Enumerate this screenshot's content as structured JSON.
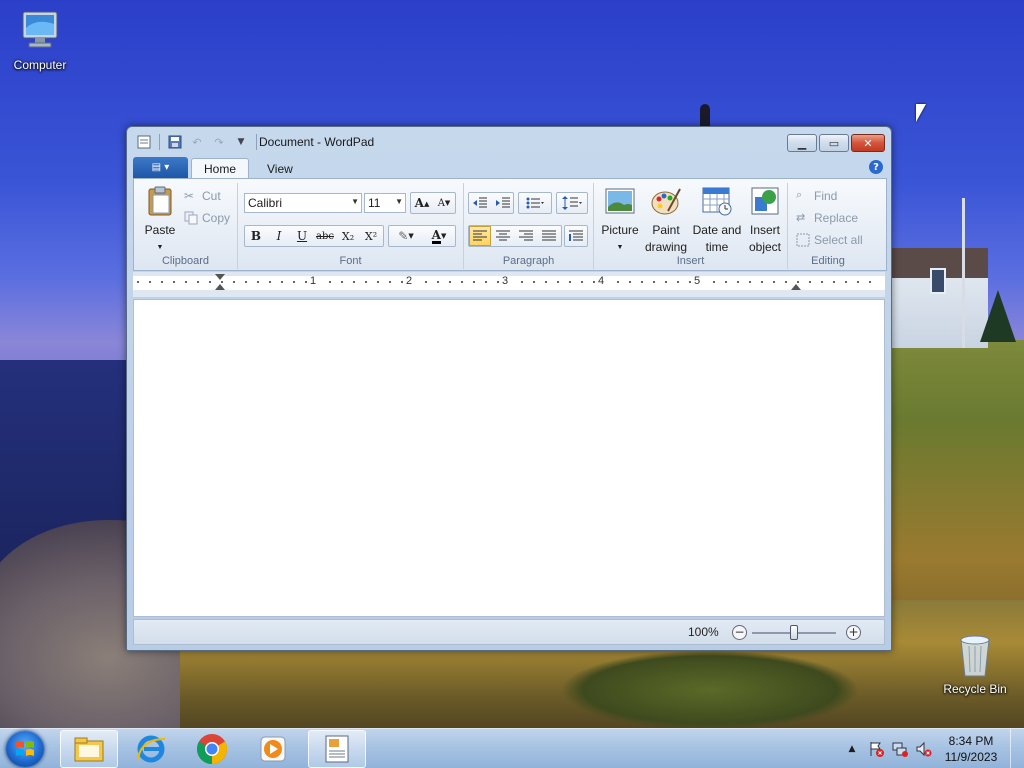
{
  "desktop": {
    "icons": [
      {
        "label": "Computer"
      },
      {
        "label": "Recycle Bin"
      }
    ]
  },
  "window": {
    "title": "Document - WordPad",
    "tabs": [
      {
        "label": "Home",
        "active": true
      },
      {
        "label": "View",
        "active": false
      }
    ],
    "ribbon": {
      "clipboard": {
        "label": "Clipboard",
        "paste": "Paste",
        "cut": "Cut",
        "copy": "Copy"
      },
      "font": {
        "label": "Font",
        "family": "Calibri",
        "size": "11",
        "bold": "B",
        "italic": "I",
        "underline": "U",
        "strikethrough": "abc",
        "subscript": "X₂",
        "superscript": "X²"
      },
      "paragraph": {
        "label": "Paragraph"
      },
      "insert": {
        "label": "Insert",
        "picture": "Picture",
        "paint_line1": "Paint",
        "paint_line2": "drawing",
        "date_line1": "Date and",
        "date_line2": "time",
        "object_line1": "Insert",
        "object_line2": "object"
      },
      "editing": {
        "label": "Editing",
        "find": "Find",
        "replace": "Replace",
        "select_all": "Select all"
      }
    },
    "ruler": {
      "numbers": [
        "1",
        "2",
        "3",
        "4",
        "5"
      ]
    },
    "status": {
      "zoom": "100%"
    }
  },
  "taskbar": {
    "items": [
      {
        "icon": "file-explorer-icon"
      },
      {
        "icon": "internet-explorer-icon"
      },
      {
        "icon": "chrome-icon"
      },
      {
        "icon": "media-player-icon"
      },
      {
        "icon": "wordpad-icon",
        "active": true
      }
    ],
    "clock": {
      "time": "8:34 PM",
      "date": "11/9/2023"
    }
  },
  "colors": {
    "accent": "#1e56a8",
    "highlight_active": "#ffd35e",
    "close_button": "#c23a22"
  }
}
